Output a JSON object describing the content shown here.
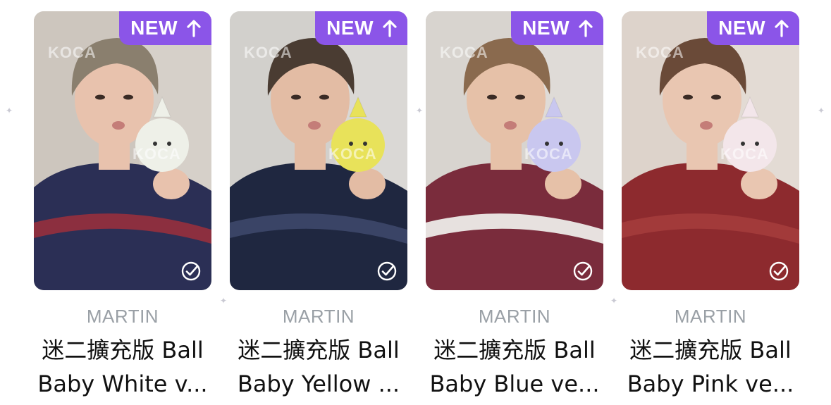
{
  "cards": [
    {
      "badge": "NEW",
      "artist": "MARTIN",
      "title_line1": "迷二擴充版 Ball",
      "title_line2": "Baby White v...",
      "watermark": "KOCA",
      "colors": {
        "bg": "#cdc6be",
        "shirt": "#2b2f55",
        "stripe": "#8c2f3f",
        "hat": "#8a7f6e",
        "plush": "#eef0e8",
        "skin": "#e8c2ad"
      }
    },
    {
      "badge": "NEW",
      "artist": "MARTIN",
      "title_line1": "迷二擴充版 Ball",
      "title_line2": "Baby Yellow ...",
      "watermark": "KOCA",
      "colors": {
        "bg": "#d2d0cc",
        "shirt": "#1f2740",
        "stripe": "#3a4466",
        "hat": "#4a3c32",
        "plush": "#e8e25a",
        "skin": "#e3bca4"
      }
    },
    {
      "badge": "NEW",
      "artist": "MARTIN",
      "title_line1": "迷二擴充版 Ball",
      "title_line2": "Baby Blue ve...",
      "watermark": "KOCA",
      "colors": {
        "bg": "#d8d4cf",
        "shirt": "#7a2c3c",
        "stripe": "#e7e1df",
        "hat": "#8a6a4e",
        "plush": "#c9c7ef",
        "skin": "#e6c1a8"
      }
    },
    {
      "badge": "NEW",
      "artist": "MARTIN",
      "title_line1": "迷二擴充版 Ball",
      "title_line2": "Baby Pink ve...",
      "watermark": "KOCA",
      "colors": {
        "bg": "#ddd3cb",
        "shirt": "#8d2a2e",
        "stripe": "#a23a3a",
        "hat": "#6a4a38",
        "plush": "#f3e6ea",
        "skin": "#e9c6b1"
      }
    }
  ]
}
